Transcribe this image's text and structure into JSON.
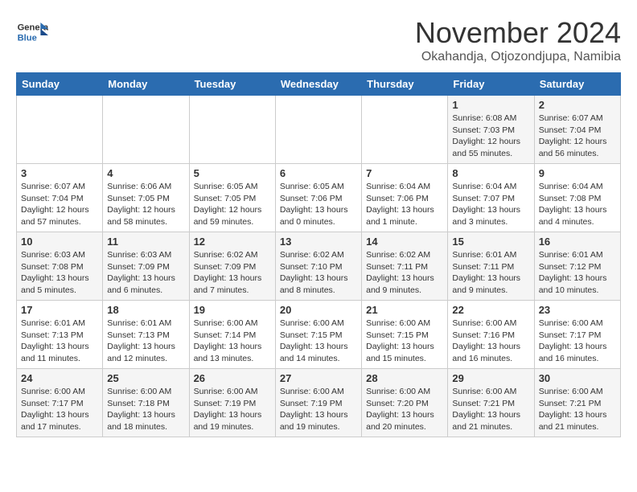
{
  "header": {
    "logo": {
      "line1": "General",
      "line2": "Blue"
    },
    "title": "November 2024",
    "location": "Okahandja, Otjozondjupa, Namibia"
  },
  "days_of_week": [
    "Sunday",
    "Monday",
    "Tuesday",
    "Wednesday",
    "Thursday",
    "Friday",
    "Saturday"
  ],
  "weeks": [
    [
      {
        "day": "",
        "text": ""
      },
      {
        "day": "",
        "text": ""
      },
      {
        "day": "",
        "text": ""
      },
      {
        "day": "",
        "text": ""
      },
      {
        "day": "",
        "text": ""
      },
      {
        "day": "1",
        "text": "Sunrise: 6:08 AM\nSunset: 7:03 PM\nDaylight: 12 hours and 55 minutes."
      },
      {
        "day": "2",
        "text": "Sunrise: 6:07 AM\nSunset: 7:04 PM\nDaylight: 12 hours and 56 minutes."
      }
    ],
    [
      {
        "day": "3",
        "text": "Sunrise: 6:07 AM\nSunset: 7:04 PM\nDaylight: 12 hours and 57 minutes."
      },
      {
        "day": "4",
        "text": "Sunrise: 6:06 AM\nSunset: 7:05 PM\nDaylight: 12 hours and 58 minutes."
      },
      {
        "day": "5",
        "text": "Sunrise: 6:05 AM\nSunset: 7:05 PM\nDaylight: 12 hours and 59 minutes."
      },
      {
        "day": "6",
        "text": "Sunrise: 6:05 AM\nSunset: 7:06 PM\nDaylight: 13 hours and 0 minutes."
      },
      {
        "day": "7",
        "text": "Sunrise: 6:04 AM\nSunset: 7:06 PM\nDaylight: 13 hours and 1 minute."
      },
      {
        "day": "8",
        "text": "Sunrise: 6:04 AM\nSunset: 7:07 PM\nDaylight: 13 hours and 3 minutes."
      },
      {
        "day": "9",
        "text": "Sunrise: 6:04 AM\nSunset: 7:08 PM\nDaylight: 13 hours and 4 minutes."
      }
    ],
    [
      {
        "day": "10",
        "text": "Sunrise: 6:03 AM\nSunset: 7:08 PM\nDaylight: 13 hours and 5 minutes."
      },
      {
        "day": "11",
        "text": "Sunrise: 6:03 AM\nSunset: 7:09 PM\nDaylight: 13 hours and 6 minutes."
      },
      {
        "day": "12",
        "text": "Sunrise: 6:02 AM\nSunset: 7:09 PM\nDaylight: 13 hours and 7 minutes."
      },
      {
        "day": "13",
        "text": "Sunrise: 6:02 AM\nSunset: 7:10 PM\nDaylight: 13 hours and 8 minutes."
      },
      {
        "day": "14",
        "text": "Sunrise: 6:02 AM\nSunset: 7:11 PM\nDaylight: 13 hours and 9 minutes."
      },
      {
        "day": "15",
        "text": "Sunrise: 6:01 AM\nSunset: 7:11 PM\nDaylight: 13 hours and 9 minutes."
      },
      {
        "day": "16",
        "text": "Sunrise: 6:01 AM\nSunset: 7:12 PM\nDaylight: 13 hours and 10 minutes."
      }
    ],
    [
      {
        "day": "17",
        "text": "Sunrise: 6:01 AM\nSunset: 7:13 PM\nDaylight: 13 hours and 11 minutes."
      },
      {
        "day": "18",
        "text": "Sunrise: 6:01 AM\nSunset: 7:13 PM\nDaylight: 13 hours and 12 minutes."
      },
      {
        "day": "19",
        "text": "Sunrise: 6:00 AM\nSunset: 7:14 PM\nDaylight: 13 hours and 13 minutes."
      },
      {
        "day": "20",
        "text": "Sunrise: 6:00 AM\nSunset: 7:15 PM\nDaylight: 13 hours and 14 minutes."
      },
      {
        "day": "21",
        "text": "Sunrise: 6:00 AM\nSunset: 7:15 PM\nDaylight: 13 hours and 15 minutes."
      },
      {
        "day": "22",
        "text": "Sunrise: 6:00 AM\nSunset: 7:16 PM\nDaylight: 13 hours and 16 minutes."
      },
      {
        "day": "23",
        "text": "Sunrise: 6:00 AM\nSunset: 7:17 PM\nDaylight: 13 hours and 16 minutes."
      }
    ],
    [
      {
        "day": "24",
        "text": "Sunrise: 6:00 AM\nSunset: 7:17 PM\nDaylight: 13 hours and 17 minutes."
      },
      {
        "day": "25",
        "text": "Sunrise: 6:00 AM\nSunset: 7:18 PM\nDaylight: 13 hours and 18 minutes."
      },
      {
        "day": "26",
        "text": "Sunrise: 6:00 AM\nSunset: 7:19 PM\nDaylight: 13 hours and 19 minutes."
      },
      {
        "day": "27",
        "text": "Sunrise: 6:00 AM\nSunset: 7:19 PM\nDaylight: 13 hours and 19 minutes."
      },
      {
        "day": "28",
        "text": "Sunrise: 6:00 AM\nSunset: 7:20 PM\nDaylight: 13 hours and 20 minutes."
      },
      {
        "day": "29",
        "text": "Sunrise: 6:00 AM\nSunset: 7:21 PM\nDaylight: 13 hours and 21 minutes."
      },
      {
        "day": "30",
        "text": "Sunrise: 6:00 AM\nSunset: 7:21 PM\nDaylight: 13 hours and 21 minutes."
      }
    ]
  ]
}
